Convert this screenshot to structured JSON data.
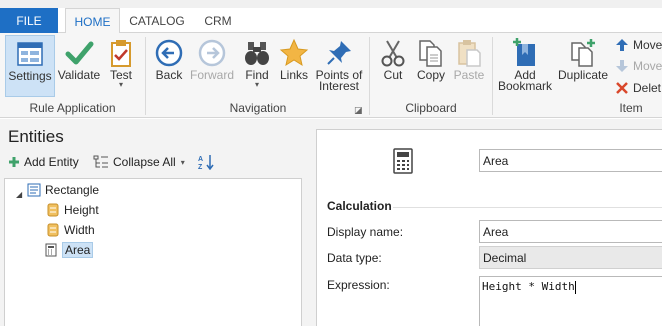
{
  "tabs": {
    "file": "FILE",
    "home": "HOME",
    "catalog": "CATALOG",
    "crm": "CRM"
  },
  "ribbon": {
    "rule_application": {
      "group_label": "Rule Application",
      "settings": "Settings",
      "validate": "Validate",
      "test": "Test"
    },
    "navigation": {
      "group_label": "Navigation",
      "back": "Back",
      "forward": "Forward",
      "find": "Find",
      "links": "Links",
      "points_of_interest_1": "Points of",
      "points_of_interest_2": "Interest"
    },
    "clipboard": {
      "group_label": "Clipboard",
      "cut": "Cut",
      "copy": "Copy",
      "paste": "Paste"
    },
    "item": {
      "group_label": "Item",
      "add_bookmark_1": "Add",
      "add_bookmark_2": "Bookmark",
      "duplicate": "Duplicate",
      "move_up": "Move",
      "move_down": "Move",
      "delete": "Delet"
    }
  },
  "entities": {
    "title": "Entities",
    "add_entity": "Add Entity",
    "collapse_all": "Collapse All",
    "tree": {
      "root": "Rectangle",
      "children": [
        "Height",
        "Width",
        "Area"
      ]
    }
  },
  "detail": {
    "name_value": "Area",
    "section": "Calculation",
    "display_name_label": "Display name:",
    "display_name_value": "Area",
    "data_type_label": "Data type:",
    "data_type_value": "Decimal",
    "expression_label": "Expression:",
    "expression_value": "Height * Width"
  },
  "colors": {
    "accent": "#1e6fc5",
    "selection": "#cde2f6",
    "ribbon_bg": "#f6f6f6"
  }
}
